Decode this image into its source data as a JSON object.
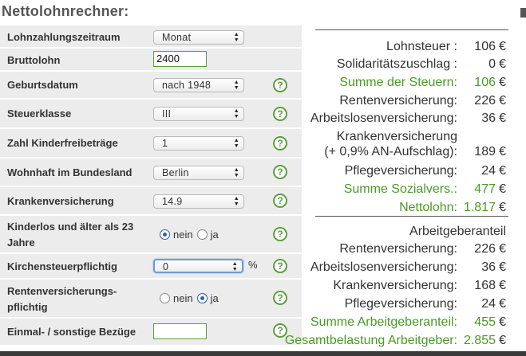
{
  "page_title": "Nettolohnrechner:",
  "form": {
    "lohnzahlungszeitraum": {
      "label": "Lohnzahlungszeitraum",
      "value": "Monat"
    },
    "bruttolohn": {
      "label": "Bruttolohn",
      "value": "2400"
    },
    "geburtsdatum": {
      "label": "Geburtsdatum",
      "value": "nach 1948"
    },
    "steuerklasse": {
      "label": "Steuerklasse",
      "value": "III"
    },
    "kinderfreibetraege": {
      "label": "Zahl Kinderfreibeträge",
      "value": "1"
    },
    "bundesland": {
      "label": "Wohnhaft im Bundesland",
      "value": "Berlin"
    },
    "krankenversicherung": {
      "label": "Krankenversicherung",
      "value": "14.9"
    },
    "kinderlos": {
      "label_line1": "Kinderlos und älter als 23",
      "label_line2": "Jahre",
      "option_nein": "nein",
      "option_ja": "ja",
      "selected": "nein"
    },
    "kirchensteuer": {
      "label": "Kirchensteuerpflichtig",
      "value": "0",
      "unit": "%"
    },
    "rentenversicherungspflichtig": {
      "label_line1": "Rentenversicherungs-",
      "label_line2": "pflichtig",
      "option_nein": "nein",
      "option_ja": "ja",
      "selected": "ja"
    },
    "einmalbezuege": {
      "label": "Einmal- / sonstige Bezüge",
      "value": ""
    },
    "help_symbol": "?"
  },
  "results": {
    "currency": "€",
    "employee": [
      {
        "label": "Lohnsteuer :",
        "value": "106",
        "highlight": false
      },
      {
        "label": "Solidaritätszuschlag :",
        "value": "0",
        "highlight": false
      },
      {
        "label": "Summe der Steuern:",
        "value": "106",
        "highlight": true
      },
      {
        "label": "Rentenversicherung:",
        "value": "226",
        "highlight": false
      },
      {
        "label": "Arbeitslosenversicherung:",
        "value": "36",
        "highlight": false
      },
      {
        "label_line1": "Krankenversicherung",
        "label": "(+ 0,9% AN-Aufschlag):",
        "value": "189",
        "highlight": false
      },
      {
        "label": "Pflegeversicherung:",
        "value": "24",
        "highlight": false
      },
      {
        "label": "Summe Sozialvers.:",
        "value": "477",
        "highlight": true
      },
      {
        "label": "Nettolohn:",
        "value": "1.817",
        "highlight": true
      }
    ],
    "employer_heading": "Arbeitgeberanteil",
    "employer": [
      {
        "label": "Rentenversicherung:",
        "value": "226",
        "highlight": false
      },
      {
        "label": "Arbeitslosenversicherung:",
        "value": "36",
        "highlight": false
      },
      {
        "label": "Krankenversicherung:",
        "value": "168",
        "highlight": false
      },
      {
        "label": "Pflegeversicherung:",
        "value": "24",
        "highlight": false
      },
      {
        "label": "Summe Arbeitgeberanteil:",
        "value": "455",
        "highlight": true
      },
      {
        "label": "Gesamtbelastung Arbeitgeber:",
        "value": "2.855",
        "highlight": true
      }
    ]
  },
  "colors": {
    "accent_green": "#4a9a25",
    "row_bg": "#ececec",
    "focus_blue": "#6b9bd8"
  }
}
